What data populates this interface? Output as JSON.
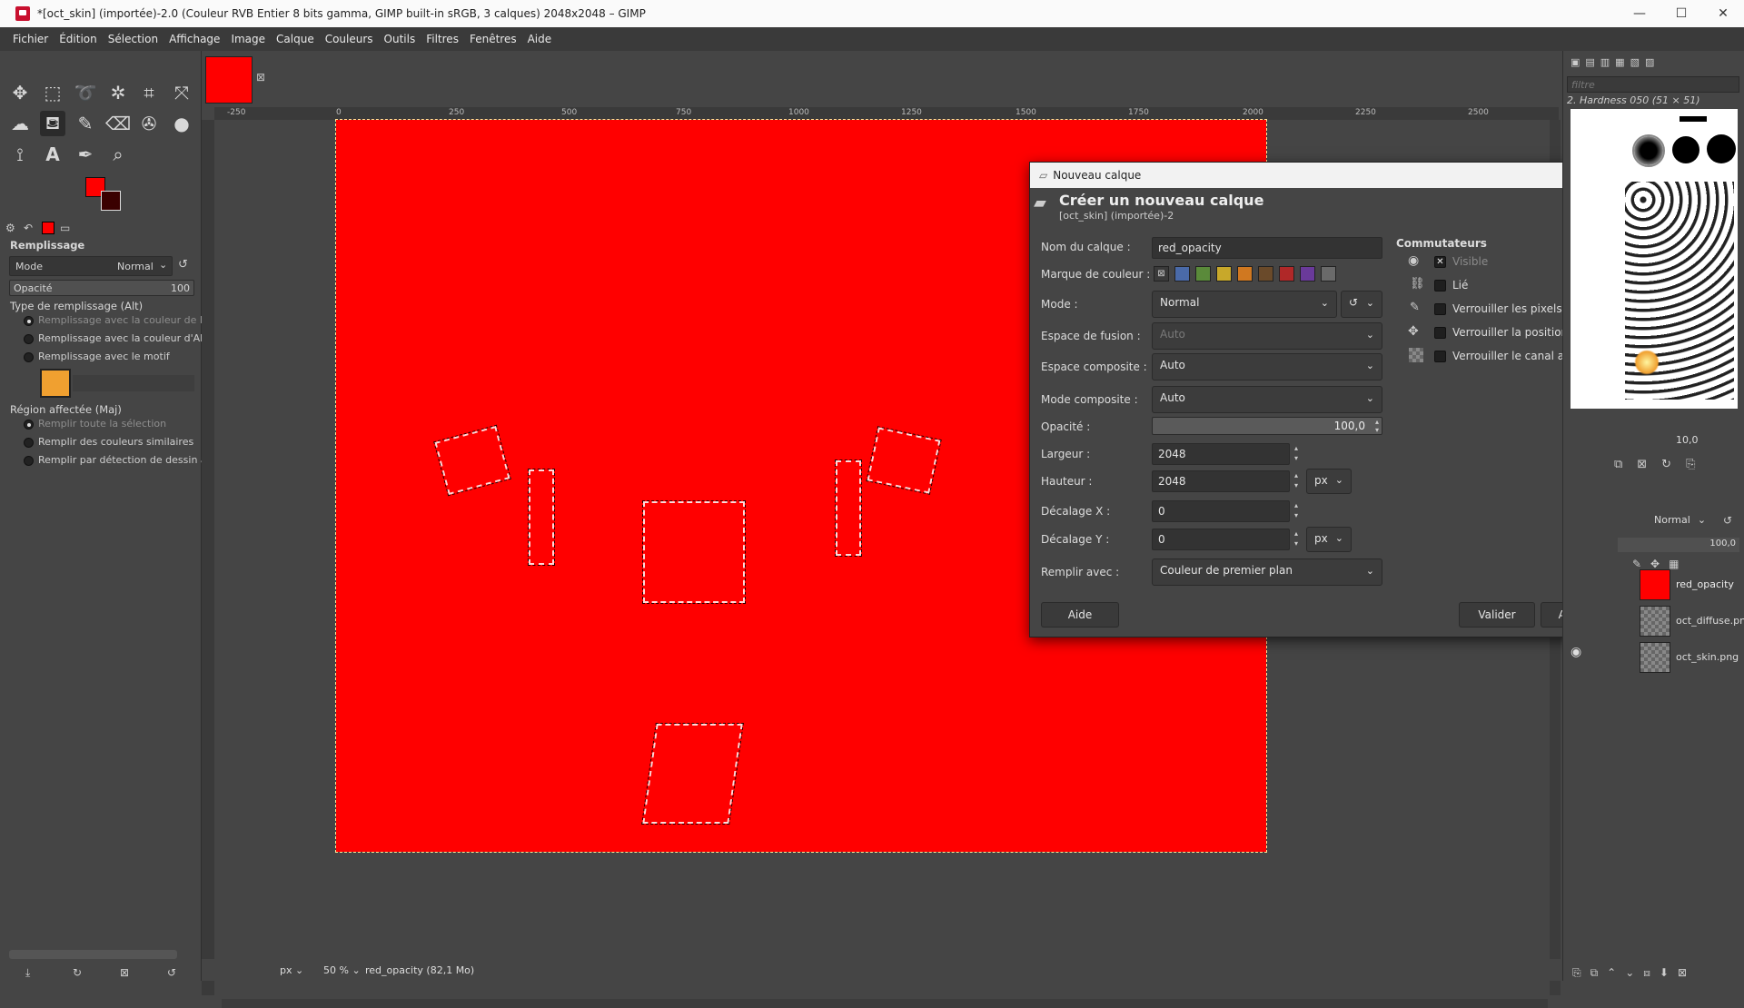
{
  "window": {
    "title": "*[oct_skin] (importée)-2.0 (Couleur RVB Entier 8 bits gamma, GIMP built-in sRGB, 3 calques) 2048x2048 – GIMP",
    "minimize": "—",
    "maximize": "☐",
    "close": "✕"
  },
  "menu": [
    "Fichier",
    "Édition",
    "Sélection",
    "Affichage",
    "Image",
    "Calque",
    "Couleurs",
    "Outils",
    "Filtres",
    "Fenêtres",
    "Aide"
  ],
  "tool_options": {
    "title": "Remplissage",
    "mode_label": "Mode",
    "mode_value": "Normal",
    "opacity_label": "Opacité",
    "opacity_value": "100",
    "fill_type_title": "Type de remplissage (Alt)",
    "fill_options": [
      "Remplissage avec la couleur de PP",
      "Remplissage avec la couleur d'AP",
      "Remplissage avec le motif"
    ],
    "region_title": "Région affectée (Maj)",
    "region_options": [
      "Remplir toute la sélection",
      "Remplir des couleurs similaires",
      "Remplir par détection de dessin au"
    ]
  },
  "rulers": {
    "h": [
      "-250",
      "0",
      "250",
      "500",
      "750",
      "1000",
      "1250",
      "1500",
      "1750",
      "2000",
      "2250",
      "2500"
    ]
  },
  "dialog": {
    "title": "Nouveau calque",
    "heading": "Créer un nouveau calque",
    "subheading": "[oct_skin] (importée)-2",
    "labels": {
      "name": "Nom du calque :",
      "color_tag": "Marque de couleur :",
      "mode": "Mode :",
      "blend_space": "Espace de fusion :",
      "composite_space": "Espace composite :",
      "composite_mode": "Mode composite :",
      "opacity": "Opacité :",
      "width": "Largeur :",
      "height": "Hauteur :",
      "offset_x": "Décalage X :",
      "offset_y": "Décalage Y :",
      "fill": "Remplir avec :"
    },
    "values": {
      "name": "red_opacity",
      "mode": "Normal",
      "blend_space": "Auto",
      "composite_space": "Auto",
      "composite_mode": "Auto",
      "opacity": "100,0",
      "width": "2048",
      "height": "2048",
      "offset_x": "0",
      "offset_y": "0",
      "unit": "px",
      "fill": "Couleur de premier plan"
    },
    "switches_title": "Commutateurs",
    "switches": [
      "Visible",
      "Lié",
      "Verrouiller les pixels",
      "Verrouiller la position et la taille",
      "Verrouiller le canal alpha"
    ],
    "buttons": {
      "help": "Aide",
      "ok": "Valider",
      "cancel": "Annuler"
    },
    "tag_colors": [
      "#4a6aa8",
      "#5a8a3a",
      "#c8a82a",
      "#d07820",
      "#6a4a2a",
      "#b02828",
      "#6a3a9a",
      "#6a6a6a"
    ]
  },
  "right_dock": {
    "filter_placeholder": "filtre",
    "brush_name": "2. Hardness 050 (51 × 51)",
    "size_value": "10,0",
    "layer_mode": "Normal",
    "layer_opacity": "100,0",
    "layers": [
      "red_opacity",
      "oct_diffuse.png",
      "oct_skin.png"
    ]
  },
  "status": {
    "unit": "px",
    "zoom": "50 %",
    "info": "red_opacity (82,1 Mo)"
  },
  "colors": {
    "foreground": "#ff0000",
    "background": "#3a0000"
  }
}
